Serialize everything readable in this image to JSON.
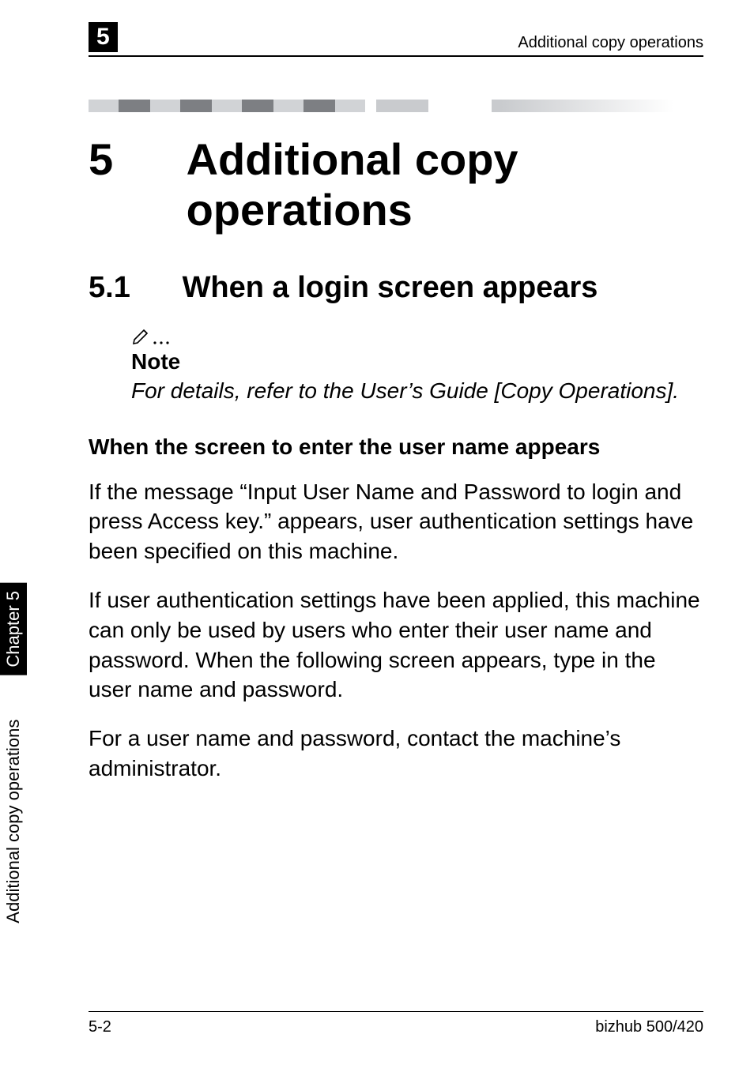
{
  "runningHeader": {
    "chapterNumber": "5",
    "title": "Additional copy operations"
  },
  "sideTab": {
    "label": "Additional copy operations",
    "chapterLabel": "Chapter 5"
  },
  "chapter": {
    "number": "5",
    "title": "Additional copy operations"
  },
  "section": {
    "number": "5.1",
    "title": "When a login screen appears"
  },
  "note": {
    "iconGlyph": "✎…",
    "label": "Note",
    "text": "For details, refer to the User’s Guide [Copy Operations]."
  },
  "subheading": "When the screen to enter the user name appears",
  "paragraphs": [
    "If the message “Input User Name and Password to login and press Access key.” appears, user authentication settings have been specified on this machine.",
    "If user authentication settings have been applied, this machine can only be used by users who enter their user name and password. When the following screen appears, type in the user name and password.",
    "For a user name and password, contact the machine’s administrator."
  ],
  "footer": {
    "pageNumber": "5-2",
    "product": "bizhub 500/420"
  },
  "colorBars": {
    "widths": [
      38,
      40,
      38,
      40,
      38,
      40,
      38,
      40,
      38,
      14,
      66,
      80,
      12,
      218
    ],
    "colors": [
      "#d1d3d6",
      "#7d7f83",
      "#d1d3d6",
      "#7d7f83",
      "#d1d3d6",
      "#7d7f83",
      "#d1d3d6",
      "#7d7f83",
      "#d1d3d6",
      "#ffffff",
      "#c9cbce",
      "#ffffff",
      "#c9cbce",
      "linear"
    ]
  }
}
